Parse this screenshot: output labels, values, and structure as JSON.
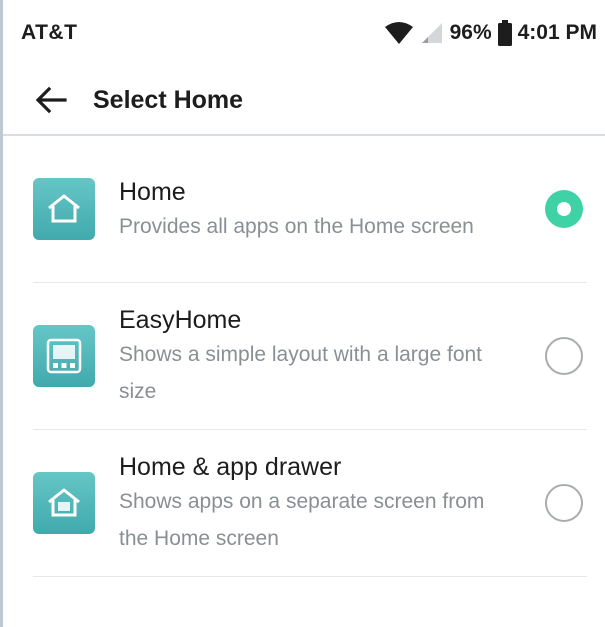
{
  "status_bar": {
    "carrier": "AT&T",
    "battery": "96%",
    "time": "4:01 PM"
  },
  "app_bar": {
    "title": "Select Home"
  },
  "options": [
    {
      "title": "Home",
      "description": "Provides all apps on the Home screen",
      "icon": "home-icon",
      "selected": true
    },
    {
      "title": "EasyHome",
      "description": "Shows a simple layout with a large font size",
      "icon": "easyhome-icon",
      "selected": false
    },
    {
      "title": "Home & app drawer",
      "description": "Shows apps on a separate screen from the Home screen",
      "icon": "home-app-drawer-icon",
      "selected": false
    }
  ],
  "colors": {
    "accent": "#3fd2a7",
    "icon_bg": "#4fb6b8"
  }
}
